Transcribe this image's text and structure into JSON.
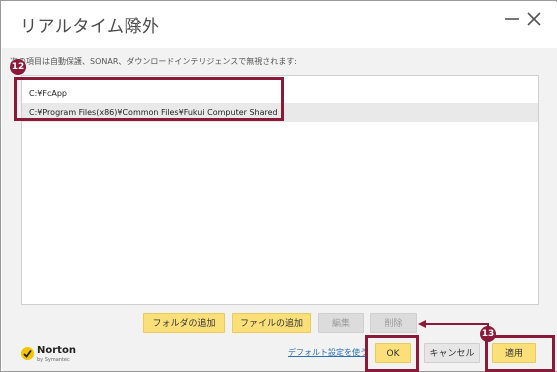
{
  "window": {
    "title": "リアルタイム除外",
    "help_glyph": "?"
  },
  "description": "次の項目は自動保護、SONAR、ダウンロードインテリジェンスで無視されます:",
  "list": {
    "items": [
      "C:¥FcApp",
      "C:¥Program Files(x86)¥Common Files¥Fukui Computer Shared"
    ]
  },
  "buttons": {
    "add_folder": "フォルダの追加",
    "add_file": "ファイルの追加",
    "edit": "編集",
    "delete": "削除",
    "ok": "OK",
    "cancel": "キャンセル",
    "apply": "適用"
  },
  "link_default": "デフォルト設定を使う",
  "brand": {
    "name": "Norton",
    "sub": "by Symantec"
  },
  "annotations": {
    "badge_12": "12",
    "badge_13": "13"
  },
  "colors": {
    "accent_callout": "#8b1a3a",
    "button_yellow": "#fbe07a",
    "background_panel": "#f2f2f2",
    "link_blue": "#2a6fb0"
  },
  "icons": [
    "minimize-icon",
    "close-icon",
    "help-icon",
    "norton-logo-icon"
  ]
}
